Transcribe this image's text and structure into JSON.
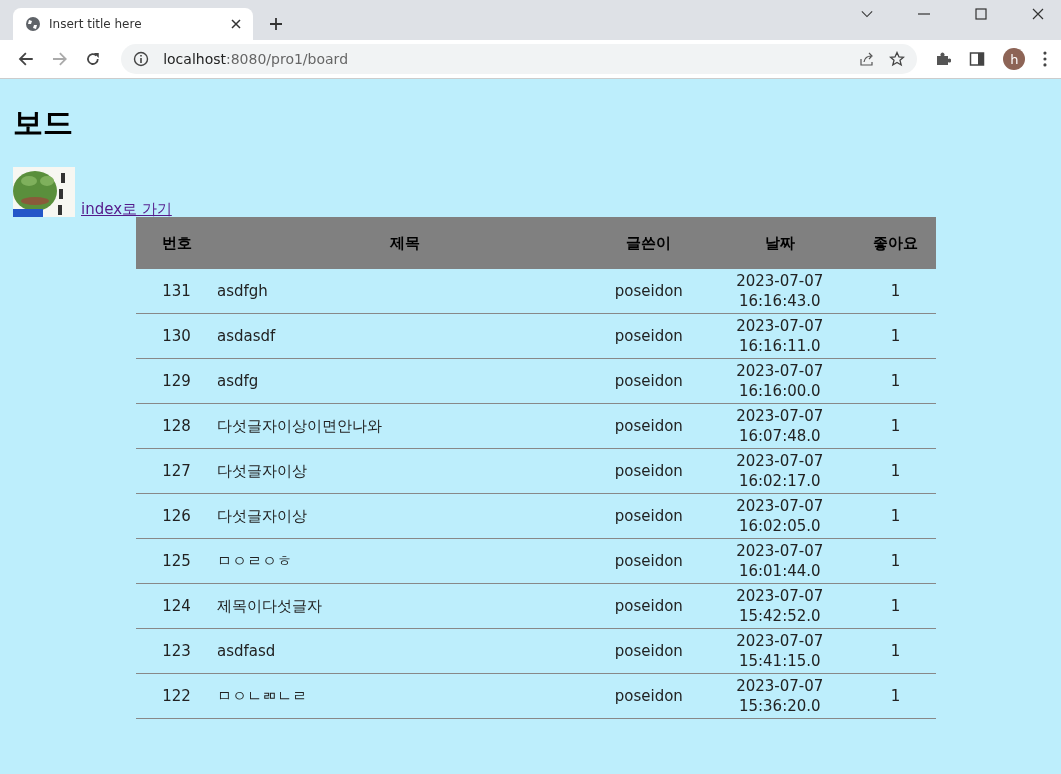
{
  "browser": {
    "tab_title": "Insert title here",
    "url_host": "localhost",
    "url_rest": ":8080/pro1/board",
    "profile_letter": "h"
  },
  "page": {
    "heading": "보드",
    "link": "index로 가기"
  },
  "table": {
    "columns": [
      "번호",
      "제목",
      "글쓴이",
      "날짜",
      "좋아요"
    ],
    "rows": [
      {
        "no": "131",
        "title": "asdfgh",
        "author": "poseidon",
        "date": "2023-07-07",
        "time": "16:16:43.0",
        "likes": "1"
      },
      {
        "no": "130",
        "title": "asdasdf",
        "author": "poseidon",
        "date": "2023-07-07",
        "time": "16:16:11.0",
        "likes": "1"
      },
      {
        "no": "129",
        "title": "asdfg",
        "author": "poseidon",
        "date": "2023-07-07",
        "time": "16:16:00.0",
        "likes": "1"
      },
      {
        "no": "128",
        "title": "다섯글자이상이면안나와",
        "author": "poseidon",
        "date": "2023-07-07",
        "time": "16:07:48.0",
        "likes": "1"
      },
      {
        "no": "127",
        "title": "다섯글자이상",
        "author": "poseidon",
        "date": "2023-07-07",
        "time": "16:02:17.0",
        "likes": "1"
      },
      {
        "no": "126",
        "title": "다섯글자이상",
        "author": "poseidon",
        "date": "2023-07-07",
        "time": "16:02:05.0",
        "likes": "1"
      },
      {
        "no": "125",
        "title": "ㅁㅇㄹㅇㅎ",
        "author": "poseidon",
        "date": "2023-07-07",
        "time": "16:01:44.0",
        "likes": "1"
      },
      {
        "no": "124",
        "title": "제목이다섯글자",
        "author": "poseidon",
        "date": "2023-07-07",
        "time": "15:42:52.0",
        "likes": "1"
      },
      {
        "no": "123",
        "title": "asdfasd",
        "author": "poseidon",
        "date": "2023-07-07",
        "time": "15:41:15.0",
        "likes": "1"
      },
      {
        "no": "122",
        "title": "ㅁㅇㄴㄻㄴㄹ",
        "author": "poseidon",
        "date": "2023-07-07",
        "time": "15:36:20.0",
        "likes": "1"
      }
    ]
  }
}
